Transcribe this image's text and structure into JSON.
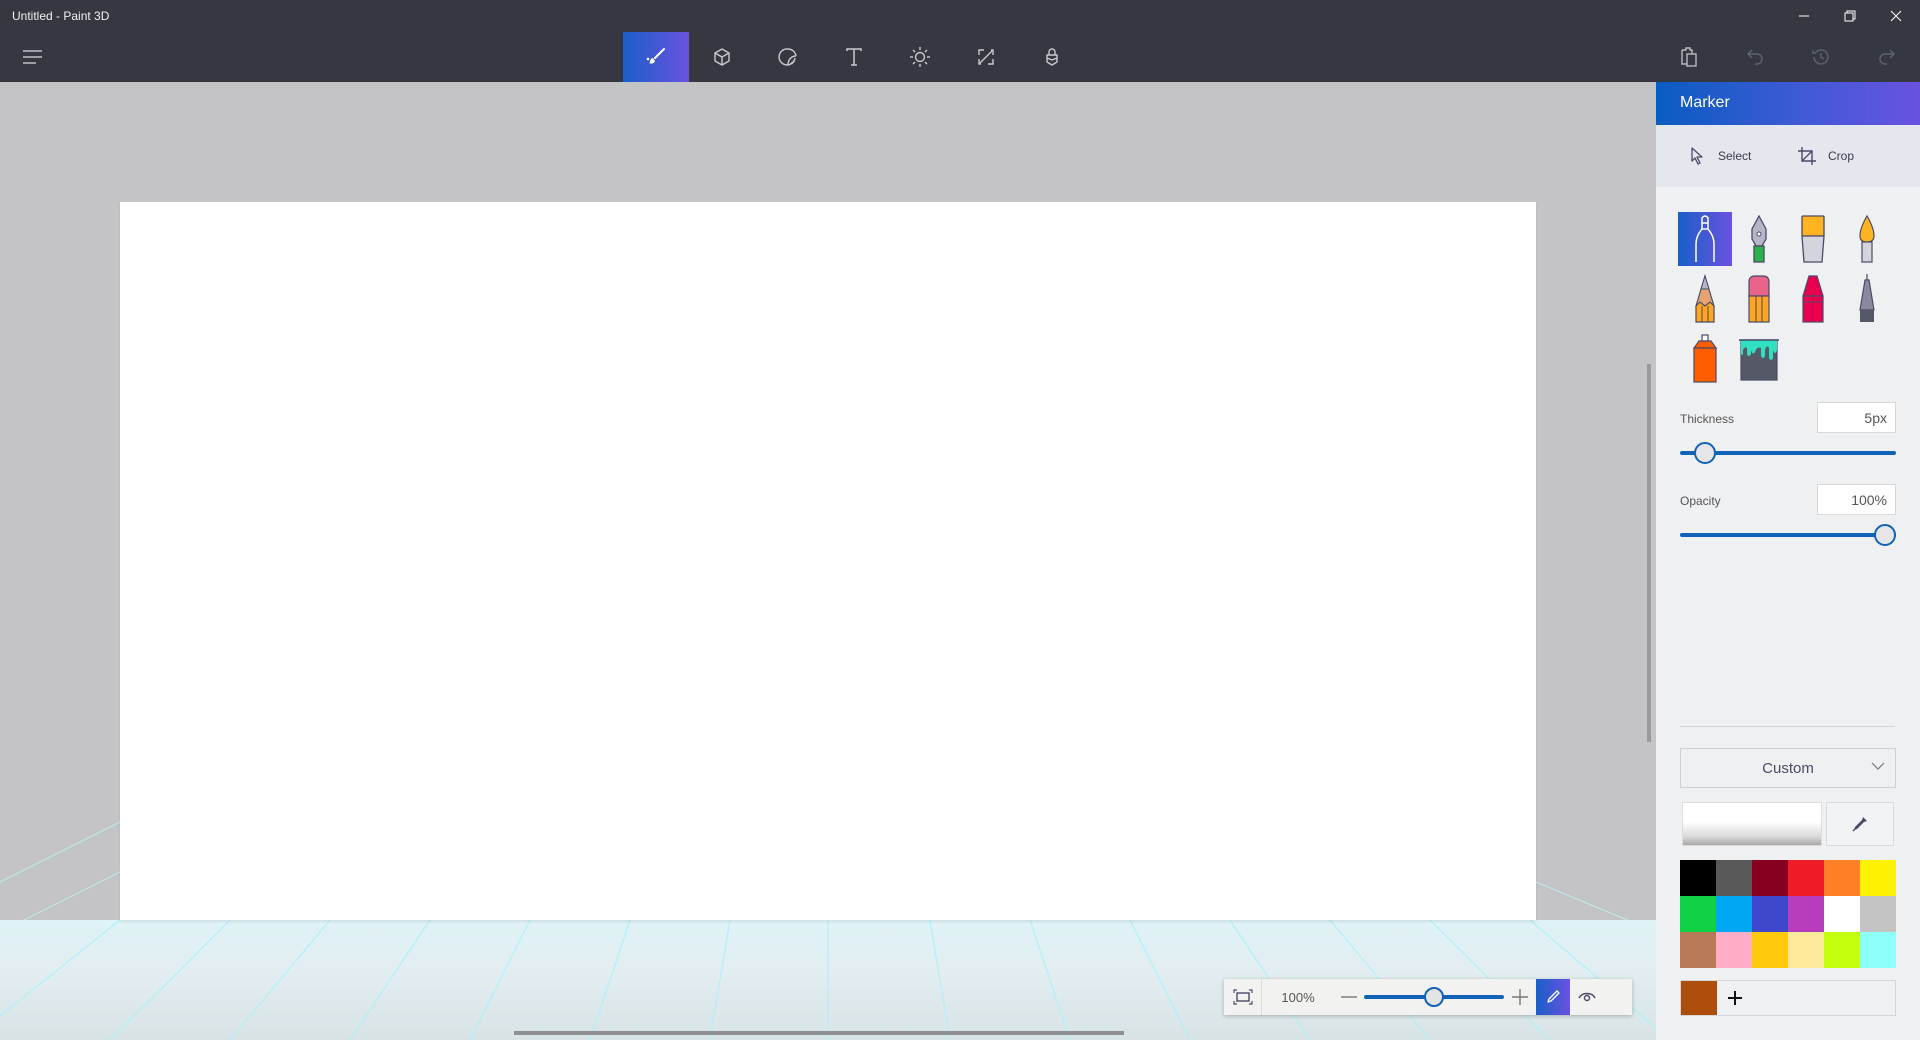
{
  "window": {
    "title": "Untitled - Paint 3D",
    "controls": [
      "minimize",
      "restore",
      "close"
    ]
  },
  "toolbar": {
    "menu_icon": "hamburger-menu-icon",
    "tools": [
      {
        "name": "Brushes",
        "icon": "brush-icon",
        "active": true
      },
      {
        "name": "3D shapes",
        "icon": "cube-icon",
        "active": false
      },
      {
        "name": "Stickers",
        "icon": "sticker-icon",
        "active": false
      },
      {
        "name": "Text",
        "icon": "text-icon",
        "active": false
      },
      {
        "name": "Effects",
        "icon": "sun-icon",
        "active": false
      },
      {
        "name": "Canvas",
        "icon": "canvas-resize-icon",
        "active": false
      },
      {
        "name": "3D library",
        "icon": "library-bag-icon",
        "active": false
      }
    ],
    "right_tools": [
      {
        "name": "Paste",
        "icon": "paste-icon",
        "enabled": true
      },
      {
        "name": "Undo",
        "icon": "undo-icon",
        "enabled": false
      },
      {
        "name": "History",
        "icon": "history-icon",
        "enabled": false
      },
      {
        "name": "Redo",
        "icon": "redo-icon",
        "enabled": false
      }
    ]
  },
  "panel": {
    "title": "Marker",
    "select_label": "Select",
    "crop_label": "Crop",
    "brushes": [
      {
        "name": "Marker",
        "active": true
      },
      {
        "name": "Calligraphy pen",
        "active": false
      },
      {
        "name": "Oil brush",
        "active": false
      },
      {
        "name": "Watercolor",
        "active": false
      },
      {
        "name": "Pixel pen",
        "active": false
      },
      {
        "name": "Pencil",
        "active": false
      },
      {
        "name": "Eraser",
        "active": false
      },
      {
        "name": "Crayon",
        "active": false
      },
      {
        "name": "Spray can",
        "active": false
      },
      {
        "name": "Fill",
        "active": false
      }
    ],
    "thickness": {
      "label": "Thickness",
      "value": "5px",
      "fraction": 0.07
    },
    "opacity": {
      "label": "Opacity",
      "value": "100%",
      "fraction": 1.0
    },
    "finish_dropdown": {
      "selected": "Custom"
    },
    "palette": [
      "#000000",
      "#595959",
      "#86001f",
      "#ee1c26",
      "#ff7f27",
      "#fff200",
      "#0fd146",
      "#00a8f3",
      "#3f48cc",
      "#b83dba",
      "#ffffff",
      "#c3c3c3",
      "#b97a57",
      "#ffaec8",
      "#ffc90e",
      "#fde99a",
      "#c4ff0e",
      "#8cfffb"
    ],
    "current_color": "#ae4e0c",
    "add_color_label": "+"
  },
  "zoom_control": {
    "value": "100%",
    "slider_fraction": 0.5,
    "minus_label": "—",
    "plus_label": "+"
  },
  "accent": "#1163b8"
}
